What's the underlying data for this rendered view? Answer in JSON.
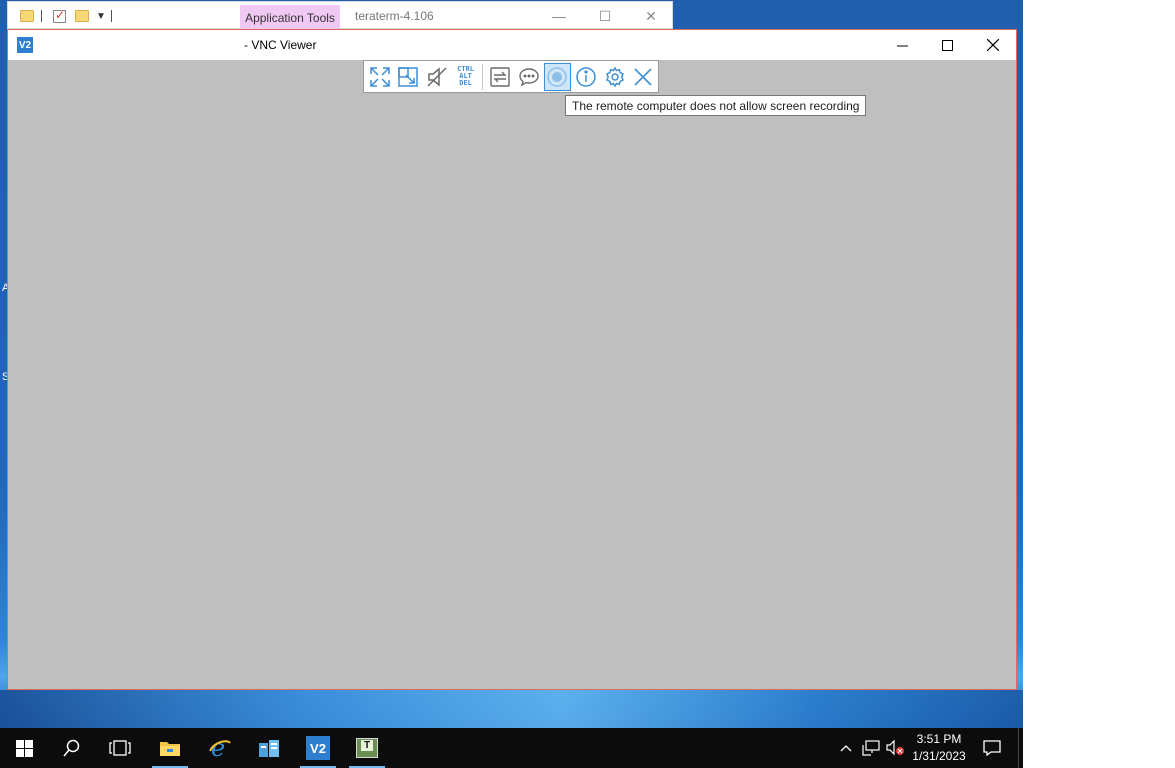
{
  "explorer": {
    "contextual_tab": "Application Tools",
    "title": "teraterm-4.106"
  },
  "vnc_window": {
    "logo_text": "V2",
    "title": "- VNC Viewer"
  },
  "toolbar": {
    "buttons": [
      {
        "icon": "fullscreen-icon"
      },
      {
        "icon": "scale-icon"
      },
      {
        "icon": "mute-icon"
      },
      {
        "icon": "ctrl-alt-del-icon",
        "label_lines": [
          "CTRL",
          "ALT",
          "DEL"
        ]
      },
      {
        "icon": "file-transfer-icon"
      },
      {
        "icon": "chat-icon"
      },
      {
        "icon": "record-icon",
        "active": true
      },
      {
        "icon": "info-icon"
      },
      {
        "icon": "settings-icon"
      },
      {
        "icon": "close-icon"
      }
    ],
    "tooltip": "The remote computer does not allow screen recording"
  },
  "taskbar": {
    "clock_time": "3:51 PM",
    "clock_date": "1/31/2023",
    "teraterm_letter": "T"
  },
  "desktop": {
    "edge_letters": [
      "A",
      "S"
    ]
  },
  "colors": {
    "accent": "#3e8fd6",
    "vnc_canvas": "#bfbfbf",
    "taskbar": "#0c0c0c",
    "app_tools_tab": "#f0c8f4"
  }
}
